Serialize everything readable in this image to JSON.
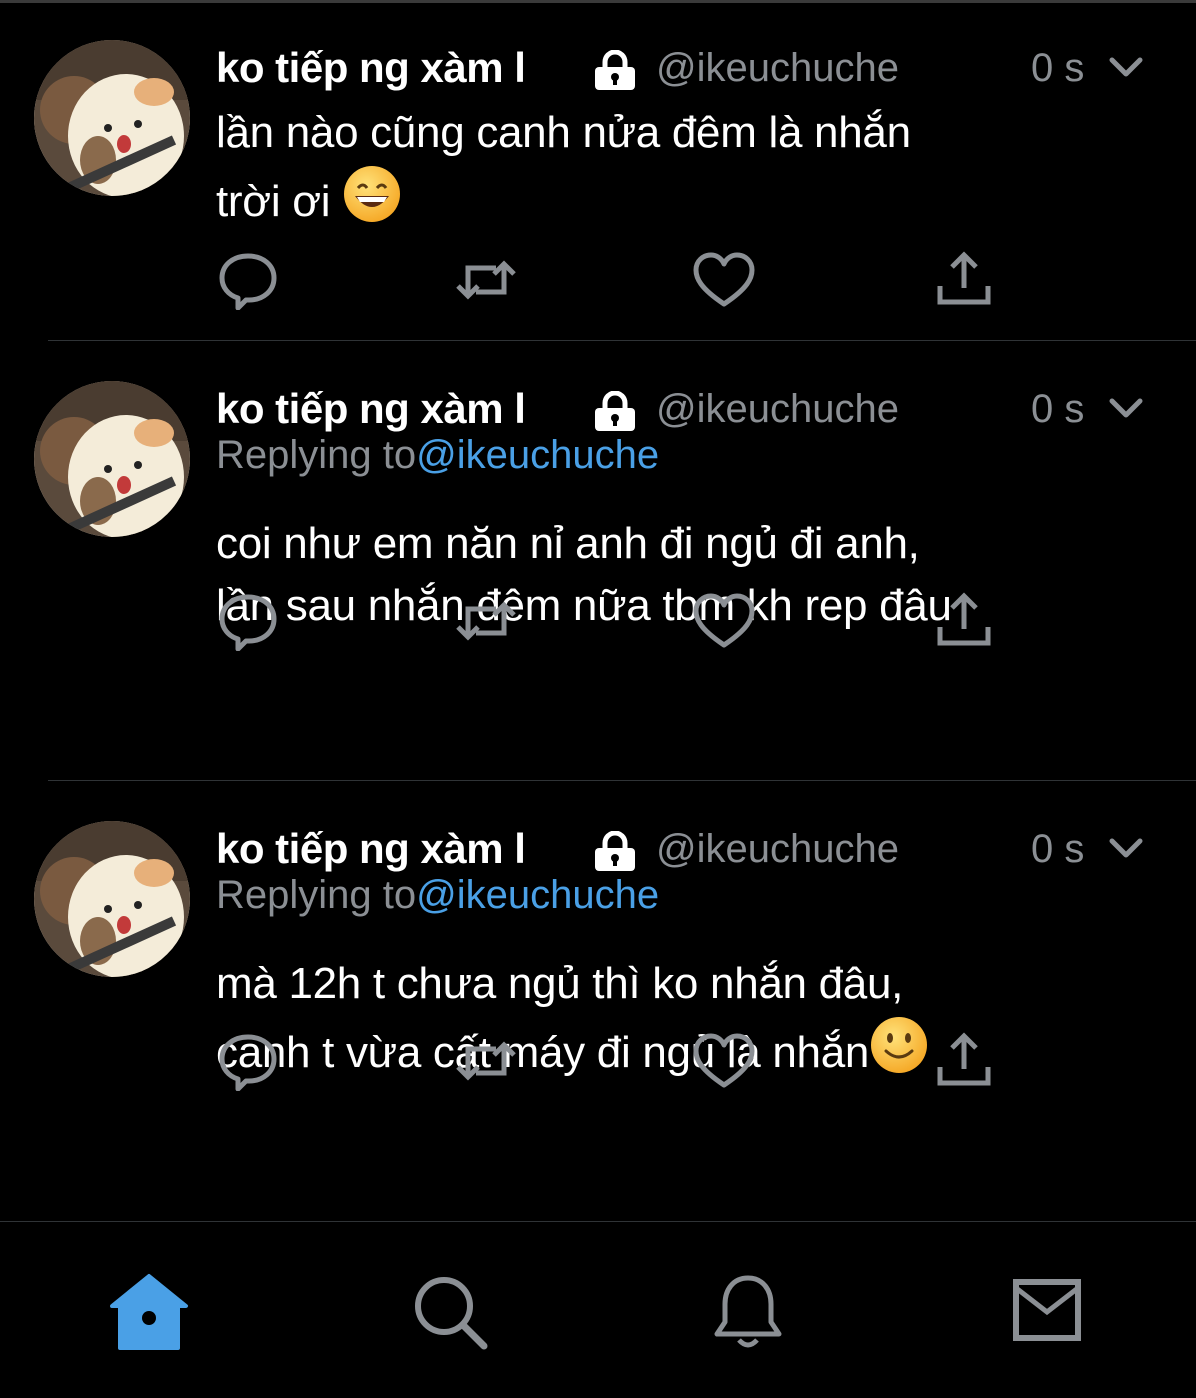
{
  "tweets": [
    {
      "name": "ko tiếp ng xàm l",
      "handle": "@ikeuchuche",
      "time": "0 s",
      "replying_prefix": "",
      "replying_handle": "",
      "text": "lần nào cũng canh nửa đêm là nhắn\ntrời ơi ",
      "emoji": "grinning-face-emoji"
    },
    {
      "name": "ko tiếp ng xàm l",
      "handle": "@ikeuchuche",
      "time": "0 s",
      "replying_prefix": "Replying to",
      "replying_handle": "@ikeuchuche",
      "text": "coi như em năn nỉ anh đi ngủ đi anh,\nlần sau nhắn đêm nữa tbm kh rep đâu",
      "emoji": ""
    },
    {
      "name": "ko tiếp ng xàm l",
      "handle": "@ikeuchuche",
      "time": "0 s",
      "replying_prefix": "Replying to",
      "replying_handle": "@ikeuchuche",
      "text": "mà 12h t chưa ngủ thì ko nhắn đâu,\ncanh t vừa cất máy đi ngủ là nhắn",
      "emoji": "slightly-smiling-face-emoji"
    }
  ],
  "action_icons": [
    "reply-icon",
    "retweet-icon",
    "like-icon",
    "share-icon"
  ],
  "tabbar": {
    "items": [
      "home-icon",
      "search-icon",
      "notifications-icon",
      "messages-icon"
    ],
    "active": "home-icon"
  },
  "colors": {
    "background": "#000000",
    "text": "#ffffff",
    "secondary": "#8b8f94",
    "accent": "#4aa0e6",
    "separator": "#2f3336"
  }
}
